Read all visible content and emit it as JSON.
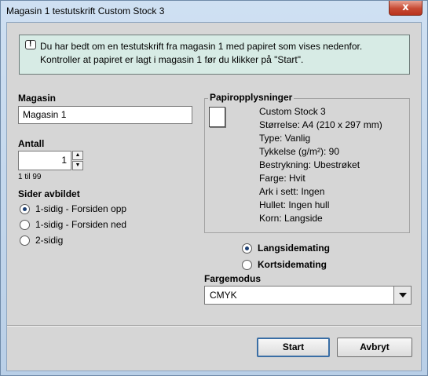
{
  "window": {
    "title": "Magasin 1 testutskrift Custom Stock 3",
    "close_label": "x"
  },
  "info": {
    "icon": "message-icon",
    "line1": "Du har bedt om en testutskrift fra magasin 1 med papiret som vises nedenfor.",
    "line2": "Kontroller at papiret er lagt i magasin 1 før du klikker på \"Start\"."
  },
  "tray": {
    "label": "Magasin",
    "value": "Magasin 1"
  },
  "quantity": {
    "label": "Antall",
    "value": "1",
    "range": "1 til 99"
  },
  "sides": {
    "label": "Sider avbildet",
    "options": [
      {
        "label": "1-sidig - Forsiden opp",
        "selected": true
      },
      {
        "label": "1-sidig - Forsiden ned",
        "selected": false
      },
      {
        "label": "2-sidig",
        "selected": false
      }
    ]
  },
  "paper": {
    "label": "Papiropplysninger",
    "name": "Custom Stock 3",
    "size": "Størrelse: A4 (210 x 297 mm)",
    "type": "Type: Vanlig",
    "weight": "Tykkelse (g/m²): 90",
    "coating": "Bestrykning: Ubestrøket",
    "color": "Farge: Hvit",
    "sets": "Ark i sett: Ingen",
    "holes": "Hullet: Ingen hull",
    "grain": "Korn: Langside"
  },
  "feed": {
    "options": [
      {
        "label": "Langsidemating",
        "selected": true
      },
      {
        "label": "Kortsidemating",
        "selected": false
      }
    ]
  },
  "color_mode": {
    "label": "Fargemodus",
    "value": "CMYK"
  },
  "buttons": {
    "start": "Start",
    "cancel": "Avbryt"
  }
}
